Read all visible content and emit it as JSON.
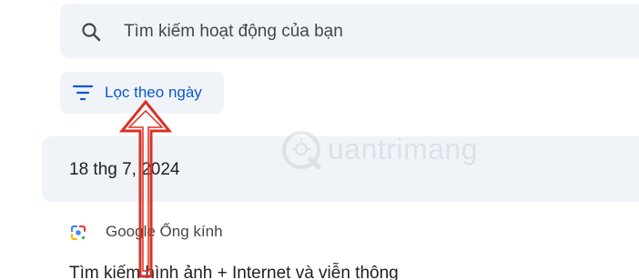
{
  "search": {
    "placeholder": "Tìm kiếm hoạt động của bạn",
    "icon": "search-icon"
  },
  "filter": {
    "label": "Lọc theo ngày",
    "icon": "filter-icon"
  },
  "date_group": {
    "heading": "18 thg 7, 2024"
  },
  "activity": {
    "product_name": "Google Ống kính",
    "product_icon": "google-lens-icon",
    "title": "Tìm kiếm hình ảnh + Internet và viễn thông"
  },
  "watermark": {
    "text": "uantrimang"
  },
  "colors": {
    "surface": "#f0f4f9",
    "accent": "#0b57d0",
    "annotation_arrow": "#d93025"
  }
}
